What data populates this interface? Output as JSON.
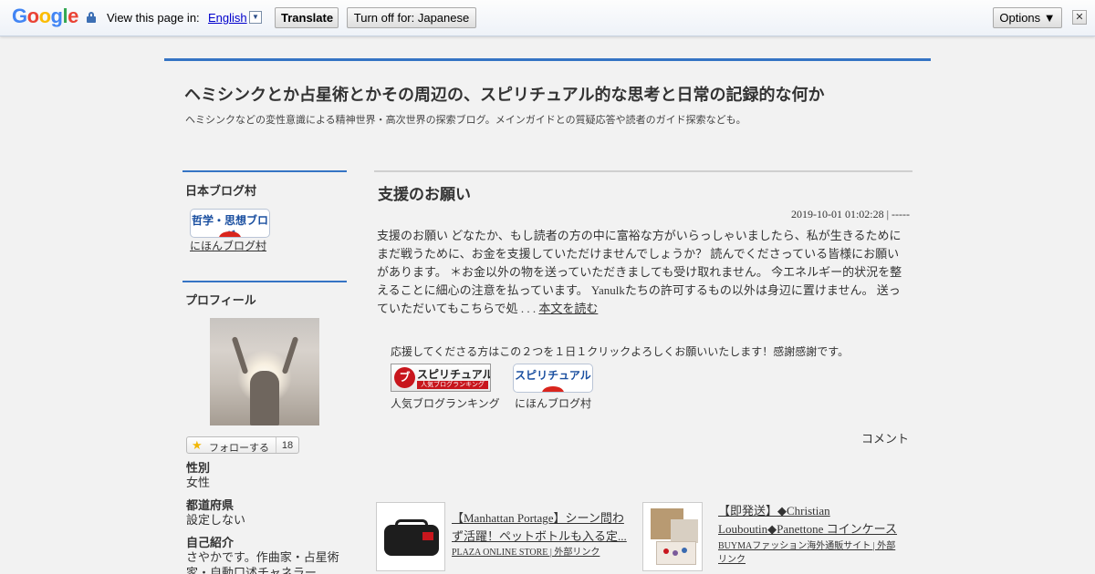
{
  "translate_bar": {
    "logo": "Google",
    "logo_letters": [
      {
        "ch": "G",
        "color": "#4285f4"
      },
      {
        "ch": "o",
        "color": "#ea4335"
      },
      {
        "ch": "o",
        "color": "#fbbc05"
      },
      {
        "ch": "g",
        "color": "#4285f4"
      },
      {
        "ch": "l",
        "color": "#34a853"
      },
      {
        "ch": "e",
        "color": "#ea4335"
      }
    ],
    "label": "View this page in:",
    "language": "English",
    "language_arrow": "▼",
    "translate_button": "Translate",
    "turn_off_button": "Turn off for: Japanese",
    "options_button": "Options ▼",
    "close_glyph": "✕"
  },
  "blog": {
    "title": "ヘミシンクとか占星術とかその周辺の、スピリチュアル的な思考と日常の記録的な何か",
    "description": "ヘミシンクなどの変性意識による精神世界・高次世界の探索ブログ。メインガイドとの質疑応答や読者のガイド探索なども。"
  },
  "sidebar": {
    "village_heading": "日本ブログ村",
    "village_banner_text": "哲学・思想ブログ",
    "village_link": "にほんブログ村",
    "profile_heading": "プロフィール",
    "follow_label": "フォローする",
    "follow_count": "18",
    "profile_fields": [
      {
        "key": "性別",
        "value": "女性"
      },
      {
        "key": "都道府県",
        "value": "設定しない"
      },
      {
        "key": "自己紹介",
        "value": "さやかです。作曲家・占星術家・自動口述チャネラー"
      }
    ]
  },
  "article": {
    "title": "支援のお願い",
    "meta": "2019-10-01 01:02:28 | -----",
    "body": "支援のお願い どなたか、もし読者の方の中に富裕な方がいらっしゃいましたら、私が生きるためにまだ戦うために、お金を支援していただけませんでしょうか？ 読んでくださっている皆様にお願いがあります。 ＊お金以外の物を送っていただきましても受け取れません。 今エネルギー的状況を整えることに細心の注意を払っています。 Yanulkたちの許可するもの以外は身辺に置けません。 送っていただいてもこちらで処 . . . ",
    "read_more": "本文を読む",
    "support_message": "応援してくださる方はこの２つを１日１クリックよろしくお願いいたします！感謝感謝です。",
    "rank_banner_top": "スピリチュアル",
    "rank_banner_sub": "人気ブログランキング",
    "rank_banner_circle": "ブ",
    "rank_link": "人気ブログランキング",
    "village_banner_text": "スピリチュアル",
    "village_link": "にほんブログ村",
    "comment_link": "コメント"
  },
  "ads": [
    {
      "title": "【Manhattan Portage】シーン問わず活躍！ペットボトルも入る定...",
      "source": "PLAZA ONLINE STORE | 外部リンク"
    },
    {
      "title": "【即発送】◆Christian Louboutin◆Panettone コインケース",
      "source": "BUYMAファッション海外通販サイト | 外部リンク"
    }
  ],
  "colors": {
    "accent": "#3574c4",
    "ranking_red": "#c8161d",
    "village_red": "#d9251d"
  }
}
